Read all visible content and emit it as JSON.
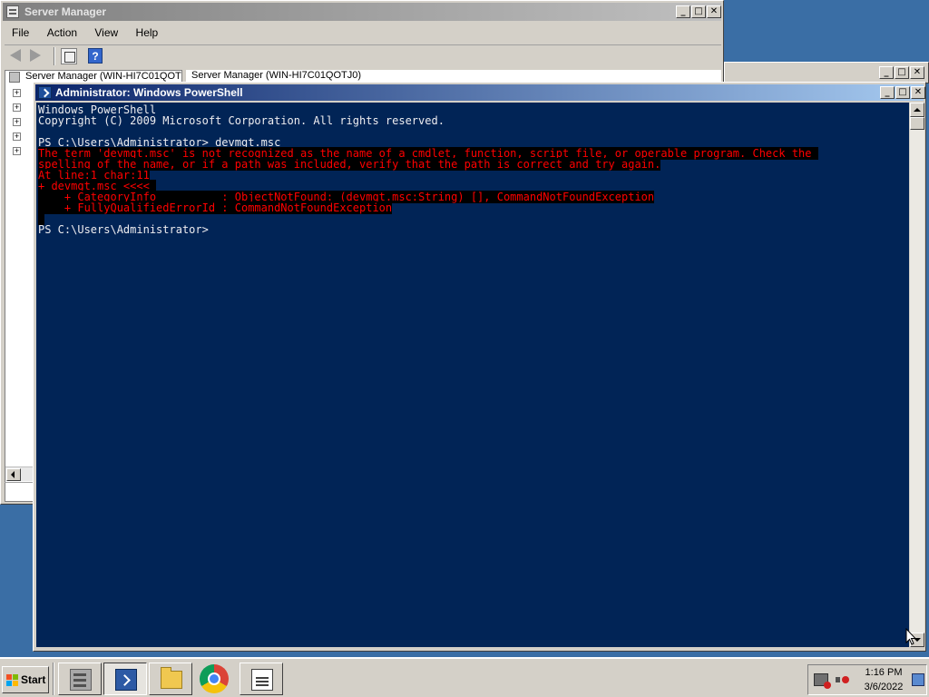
{
  "server_manager": {
    "title": "Server Manager",
    "menu": [
      "File",
      "Action",
      "View",
      "Help"
    ],
    "tree_header": "Server Manager (WIN-HI7C01QOT",
    "right_header": "Server Manager (WIN-HI7C01QOTJ0)",
    "help_icon_label": "?"
  },
  "powershell": {
    "title": "Administrator: Windows PowerShell",
    "console_lines": [
      {
        "text": "Windows PowerShell",
        "type": "normal"
      },
      {
        "text": "Copyright (C) 2009 Microsoft Corporation. All rights reserved.",
        "type": "normal"
      },
      {
        "text": "",
        "type": "blank"
      },
      {
        "text": "PS C:\\Users\\Administrator> devmgt.msc",
        "type": "normal"
      },
      {
        "text": "The term 'devmgt.msc' is not recognized as the name of a cmdlet, function, script file, or operable program. Check the ",
        "type": "error"
      },
      {
        "text": "spelling of the name, or if a path was included, verify that the path is correct and try again.",
        "type": "error"
      },
      {
        "text": "At line:1 char:11",
        "type": "error"
      },
      {
        "text": "+ devmgt.msc <<<< ",
        "type": "error"
      },
      {
        "text": "    + CategoryInfo          : ObjectNotFound: (devmgt.msc:String) [], CommandNotFoundException",
        "type": "error"
      },
      {
        "text": "    + FullyQualifiedErrorId : CommandNotFoundException",
        "type": "error"
      },
      {
        "text": " ",
        "type": "error"
      },
      {
        "text": "PS C:\\Users\\Administrator> ",
        "type": "normal"
      }
    ],
    "colors": {
      "console_background": "#012456",
      "console_text": "#eeedf0",
      "error_text": "#ff0000",
      "error_background": "#000000"
    }
  },
  "window_controls": {
    "minimize": "_",
    "maximize": "□",
    "close": "✕"
  },
  "taskbar": {
    "start_label": "Start",
    "tasks": [
      {
        "name": "server-manager",
        "icon": "server-manager-icon"
      },
      {
        "name": "windows-powershell",
        "icon": "powershell-icon"
      },
      {
        "name": "windows-explorer",
        "icon": "folder-icon"
      },
      {
        "name": "google-chrome",
        "icon": "chrome-icon"
      },
      {
        "name": "notepad",
        "icon": "notepad-icon"
      }
    ],
    "clock_time": "1:16 PM",
    "clock_date": "3/6/2022"
  }
}
